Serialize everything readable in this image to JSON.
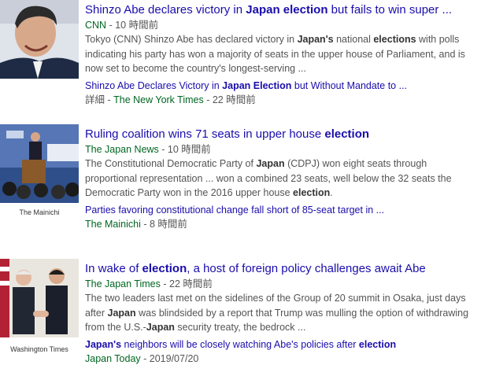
{
  "stories": [
    {
      "headline": [
        "Shinzo Abe declares victory in ",
        "Japan election",
        " but fails to win super ..."
      ],
      "publisher": "CNN",
      "time": " - 10 時間前",
      "snippet": [
        "Tokyo (CNN) Shinzo Abe has declared victory in ",
        "Japan's",
        " national ",
        "elections",
        " with polls indicating his party has won a majority of seats in the upper house of Parliament, and is now set to become the country's longest-serving ..."
      ],
      "related_title": [
        "Shinzo Abe Declares Victory in ",
        "Japan Election",
        " but Without Mandate to ..."
      ],
      "related_prefix": "詳細 - ",
      "related_publisher": "The New York Times",
      "related_time": " - 22 時間前"
    },
    {
      "headline": [
        "Ruling coalition wins 71 seats in upper house ",
        "election",
        ""
      ],
      "publisher": "The Japan News",
      "time": " - 10 時間前",
      "snippet": [
        "The Constitutional Democratic Party of ",
        "Japan",
        " (CDPJ) won eight seats through proportional representation ... won a combined 23 seats, well below the 32 seats the Democratic Party won in the 2016 upper house ",
        "election",
        "."
      ],
      "image_caption": "The Mainichi",
      "related_title": [
        "Parties favoring constitutional change fall short of 85-seat target in ...",
        "",
        ""
      ],
      "related_prefix": "",
      "related_publisher": "The Mainichi",
      "related_time": " - 8 時間前"
    },
    {
      "headline": [
        "In wake of ",
        "election",
        ", a host of foreign policy challenges await Abe"
      ],
      "publisher": "The Japan Times",
      "time": " - 22 時間前",
      "snippet": [
        "The two leaders last met on the sidelines of the Group of 20 summit in Osaka, just days after ",
        "Japan",
        " was blindsided by a report that Trump was mulling the option of withdrawing from the U.S.-",
        "Japan",
        " security treaty, the bedrock ..."
      ],
      "image_caption": "Washington Times",
      "related_title": [
        "Japan's",
        " neighbors will be closely watching Abe's policies after ",
        "election"
      ],
      "related_prefix": "",
      "related_publisher": "Japan Today",
      "related_time": " - 2019/07/20"
    }
  ],
  "colors": {
    "link": "#1a0dab",
    "publisher": "#006621",
    "snippet": "#545454"
  }
}
